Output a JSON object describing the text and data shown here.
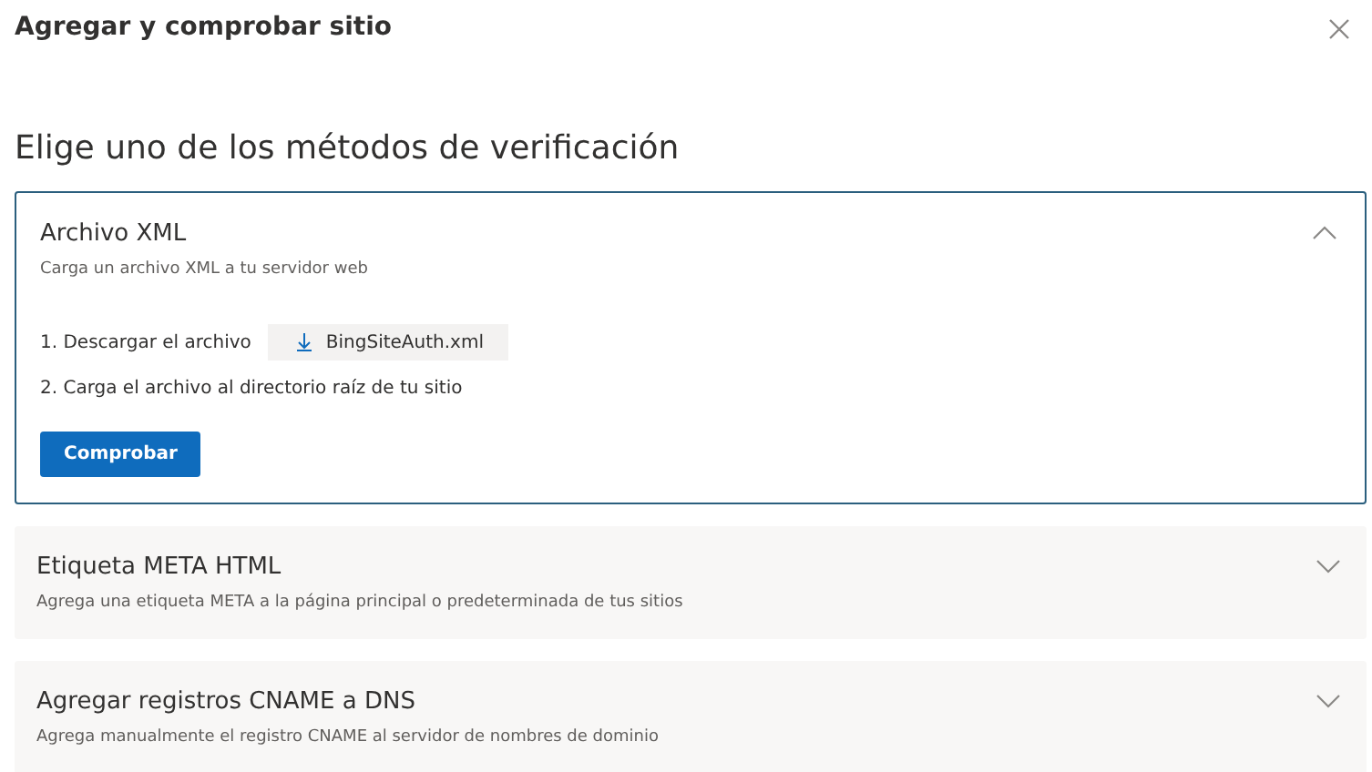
{
  "dialog": {
    "title": "Agregar y comprobar sitio"
  },
  "heading": "Elige uno de los métodos de verificación",
  "methods": [
    {
      "title": "Archivo XML",
      "description": "Carga un archivo XML a tu servidor web",
      "expanded": true,
      "steps": [
        {
          "text": "1. Descargar el archivo",
          "file": "BingSiteAuth.xml"
        },
        {
          "text": "2. Carga el archivo al directorio raíz de tu sitio"
        }
      ],
      "button": "Comprobar"
    },
    {
      "title": "Etiqueta META HTML",
      "description": "Agrega una etiqueta META a la página principal o predeterminada de tus sitios",
      "expanded": false
    },
    {
      "title": "Agregar registros CNAME a DNS",
      "description": "Agrega manualmente el registro CNAME al servidor de nombres de dominio",
      "expanded": false
    }
  ]
}
